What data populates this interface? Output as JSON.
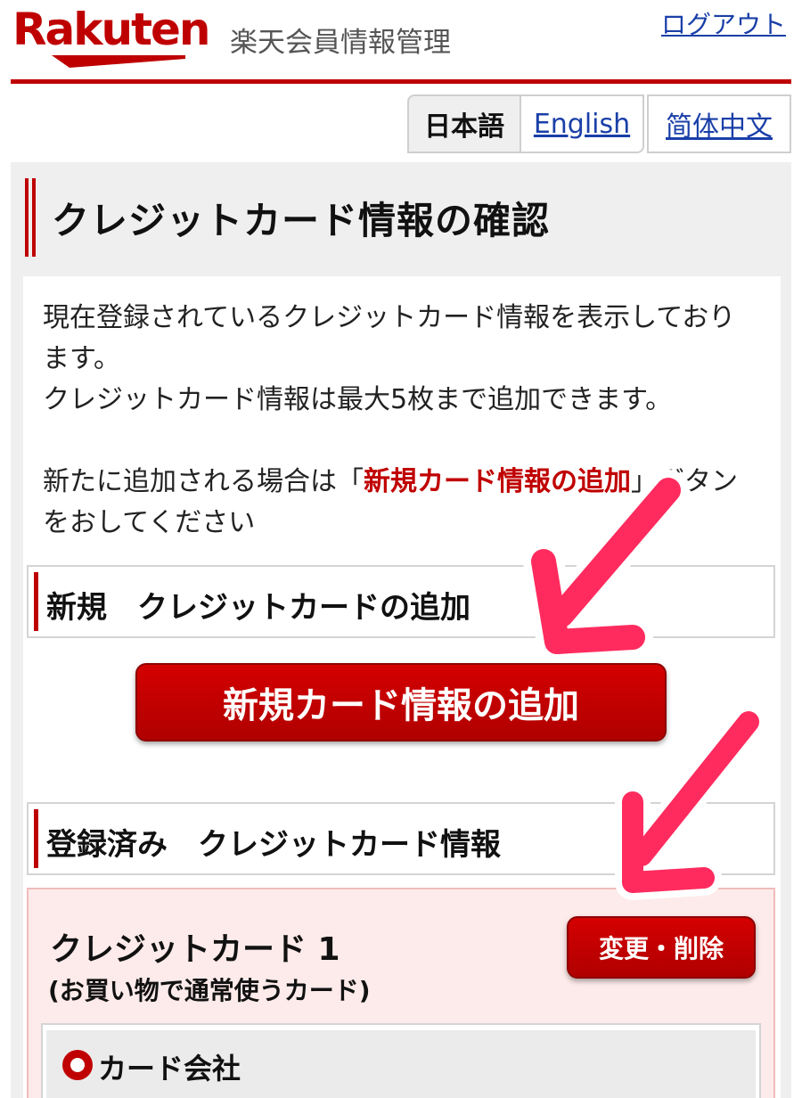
{
  "header": {
    "logo_text": "Rakuten",
    "site_title": "楽天会員情報管理",
    "logout_label": "ログアウト"
  },
  "languages": [
    {
      "label": "日本語",
      "active": true
    },
    {
      "label": "English",
      "active": false
    },
    {
      "label": "简体中文",
      "active": false
    }
  ],
  "page": {
    "title": "クレジットカード情報の確認",
    "intro_line1": "現在登録されているクレジットカード情報を表示しております。",
    "intro_line2": "クレジットカード情報は最大5枚まで追加できます。",
    "intro_line3_prefix": "新たに追加される場合は「",
    "intro_line3_emph": "新規カード情報の追加",
    "intro_line3_suffix": "」ボタンをおしてください"
  },
  "new_section": {
    "heading": "新規　クレジットカードの追加",
    "add_button_label": "新規カード情報の追加"
  },
  "registered_section": {
    "heading": "登録済み　クレジットカード情報",
    "card_title": "クレジットカード 1",
    "card_subtitle": "(お買い物で通常使うカード)",
    "edit_button_label": "変更・削除",
    "company_label": "カード会社"
  },
  "colors": {
    "brand_red": "#bf0000",
    "link_blue": "#1a3fa8",
    "annotation_pink": "#ff2b5e"
  },
  "icons": {
    "radio": "radio-icon",
    "arrows": "annotation-arrow-icon"
  }
}
